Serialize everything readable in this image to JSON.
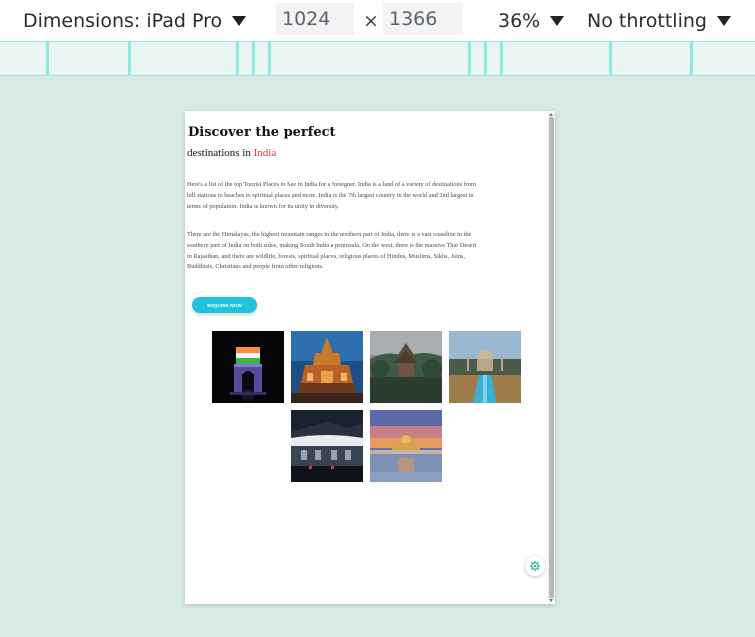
{
  "toolbar": {
    "dimensions_label": "Dimensions: iPad Pro",
    "width_value": "1024",
    "times_symbol": "×",
    "height_value": "1366",
    "zoom_label": "36%",
    "throttling_label": "No throttling"
  },
  "page": {
    "title": "Discover the perfect",
    "subtitle_prefix": "destinations in ",
    "subtitle_highlight": "India",
    "paragraph_1": "Here's a list of the top Tourist Places to See in India for a foreigner. India is a land of a variety of destinations from hill stations to beaches to spiritual places and more. India is the 7th largest country in the world and 2nd largest in terms of population. India is known for its unity in diversity.",
    "paragraph_2": "There are the Himalayas, the highest mountain ranges in the northern part of India, there is a vast coastline in the southern part of India on both sides, making South India a peninsula. On the west, there is the massive Thar Desert in Rajasthan, and there are wildlife, forests, spiritual places, religious places of Hindus, Muslims, Sikhs, Jains, Buddhists, Christians and people from other religions.",
    "cta_label": "ENQUIRE NOW",
    "accent_color": "#e53935",
    "cta_color": "#1fc3dc"
  },
  "gallery": [
    {
      "subject": "india-gate-at-night"
    },
    {
      "subject": "hindu-temple-at-sunset"
    },
    {
      "subject": "pagoda-in-forest"
    },
    {
      "subject": "taj-mahal-reflection-pool"
    },
    {
      "subject": "palace-at-night"
    },
    {
      "subject": "golden-temple-at-sunset"
    }
  ]
}
